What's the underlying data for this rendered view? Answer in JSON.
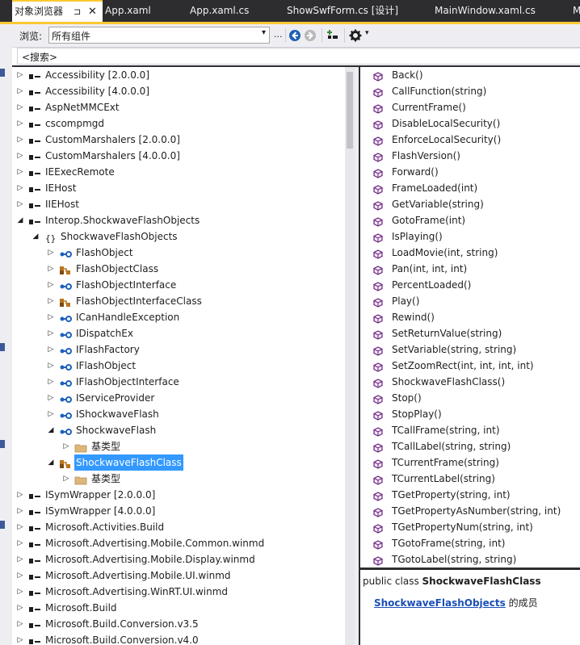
{
  "tabs": {
    "active": {
      "label": "对象浏览器",
      "pin": "⊐",
      "close": "✕"
    },
    "others": [
      "App.xaml",
      "App.xaml.cs",
      "ShowSwfForm.cs [设计]",
      "MainWindow.xaml.cs",
      "M"
    ]
  },
  "toolbar": {
    "browse_label": "浏览:",
    "browse_value": "所有组件",
    "more": "..."
  },
  "search": {
    "text": "<搜索>"
  },
  "tree": [
    {
      "label": "Accessibility [2.0.0.0]",
      "depth": 0,
      "icon": "assembly-icon",
      "exp": "collapsed"
    },
    {
      "label": "Accessibility [4.0.0.0]",
      "depth": 0,
      "icon": "assembly-icon",
      "exp": "collapsed"
    },
    {
      "label": "AspNetMMCExt",
      "depth": 0,
      "icon": "assembly-icon",
      "exp": "collapsed"
    },
    {
      "label": "cscompmgd",
      "depth": 0,
      "icon": "assembly-icon",
      "exp": "collapsed"
    },
    {
      "label": "CustomMarshalers [2.0.0.0]",
      "depth": 0,
      "icon": "assembly-icon",
      "exp": "collapsed"
    },
    {
      "label": "CustomMarshalers [4.0.0.0]",
      "depth": 0,
      "icon": "assembly-icon",
      "exp": "collapsed"
    },
    {
      "label": "IEExecRemote",
      "depth": 0,
      "icon": "assembly-icon",
      "exp": "collapsed"
    },
    {
      "label": "IEHost",
      "depth": 0,
      "icon": "assembly-icon",
      "exp": "collapsed"
    },
    {
      "label": "IIEHost",
      "depth": 0,
      "icon": "assembly-icon",
      "exp": "collapsed"
    },
    {
      "label": "Interop.ShockwaveFlashObjects",
      "depth": 0,
      "icon": "assembly-icon",
      "exp": "expanded"
    },
    {
      "label": "ShockwaveFlashObjects",
      "depth": 1,
      "icon": "namespace-icon",
      "exp": "expanded"
    },
    {
      "label": "FlashObject",
      "depth": 2,
      "icon": "interface-icon",
      "exp": "collapsed"
    },
    {
      "label": "FlashObjectClass",
      "depth": 2,
      "icon": "class-icon",
      "exp": "collapsed"
    },
    {
      "label": "FlashObjectInterface",
      "depth": 2,
      "icon": "interface-icon",
      "exp": "collapsed"
    },
    {
      "label": "FlashObjectInterfaceClass",
      "depth": 2,
      "icon": "class-icon",
      "exp": "collapsed"
    },
    {
      "label": "ICanHandleException",
      "depth": 2,
      "icon": "interface-icon",
      "exp": "collapsed"
    },
    {
      "label": "IDispatchEx",
      "depth": 2,
      "icon": "interface-icon",
      "exp": "collapsed"
    },
    {
      "label": "IFlashFactory",
      "depth": 2,
      "icon": "interface-icon",
      "exp": "collapsed"
    },
    {
      "label": "IFlashObject",
      "depth": 2,
      "icon": "interface-icon",
      "exp": "collapsed"
    },
    {
      "label": "IFlashObjectInterface",
      "depth": 2,
      "icon": "interface-icon",
      "exp": "collapsed"
    },
    {
      "label": "IServiceProvider",
      "depth": 2,
      "icon": "interface-icon",
      "exp": "collapsed"
    },
    {
      "label": "IShockwaveFlash",
      "depth": 2,
      "icon": "interface-icon",
      "exp": "collapsed"
    },
    {
      "label": "ShockwaveFlash",
      "depth": 2,
      "icon": "interface-icon",
      "exp": "expanded"
    },
    {
      "label": "基类型",
      "depth": 3,
      "icon": "folder-icon",
      "exp": "collapsed"
    },
    {
      "label": "ShockwaveFlashClass",
      "depth": 2,
      "icon": "class-icon",
      "exp": "expanded",
      "selected": true
    },
    {
      "label": "基类型",
      "depth": 3,
      "icon": "folder-icon",
      "exp": "collapsed"
    },
    {
      "label": "ISymWrapper [2.0.0.0]",
      "depth": 0,
      "icon": "assembly-icon",
      "exp": "collapsed"
    },
    {
      "label": "ISymWrapper [4.0.0.0]",
      "depth": 0,
      "icon": "assembly-icon",
      "exp": "collapsed"
    },
    {
      "label": "Microsoft.Activities.Build",
      "depth": 0,
      "icon": "assembly-icon",
      "exp": "collapsed"
    },
    {
      "label": "Microsoft.Advertising.Mobile.Common.winmd",
      "depth": 0,
      "icon": "assembly-icon",
      "exp": "collapsed"
    },
    {
      "label": "Microsoft.Advertising.Mobile.Display.winmd",
      "depth": 0,
      "icon": "assembly-icon",
      "exp": "collapsed"
    },
    {
      "label": "Microsoft.Advertising.Mobile.UI.winmd",
      "depth": 0,
      "icon": "assembly-icon",
      "exp": "collapsed"
    },
    {
      "label": "Microsoft.Advertising.WinRT.UI.winmd",
      "depth": 0,
      "icon": "assembly-icon",
      "exp": "collapsed"
    },
    {
      "label": "Microsoft.Build",
      "depth": 0,
      "icon": "assembly-icon",
      "exp": "collapsed"
    },
    {
      "label": "Microsoft.Build.Conversion.v3.5",
      "depth": 0,
      "icon": "assembly-icon",
      "exp": "collapsed"
    },
    {
      "label": "Microsoft.Build.Conversion.v4.0",
      "depth": 0,
      "icon": "assembly-icon",
      "exp": "collapsed"
    }
  ],
  "members": [
    "Back()",
    "CallFunction(string)",
    "CurrentFrame()",
    "DisableLocalSecurity()",
    "EnforceLocalSecurity()",
    "FlashVersion()",
    "Forward()",
    "FrameLoaded(int)",
    "GetVariable(string)",
    "GotoFrame(int)",
    "IsPlaying()",
    "LoadMovie(int, string)",
    "Pan(int, int, int)",
    "PercentLoaded()",
    "Play()",
    "Rewind()",
    "SetReturnValue(string)",
    "SetVariable(string, string)",
    "SetZoomRect(int, int, int, int)",
    "ShockwaveFlashClass()",
    "Stop()",
    "StopPlay()",
    "TCallFrame(string, int)",
    "TCallLabel(string, string)",
    "TCurrentFrame(string)",
    "TCurrentLabel(string)",
    "TGetProperty(string, int)",
    "TGetPropertyAsNumber(string, int)",
    "TGetPropertyNum(string, int)",
    "TGotoFrame(string, int)",
    "TGotoLabel(string, string)"
  ],
  "description": {
    "prefix": "public class ",
    "class_name": "ShockwaveFlashClass",
    "namespace_link": "ShockwaveFlashObjects",
    "suffix": " 的成员"
  },
  "colors": {
    "accent": "#fcc832",
    "selection": "#3399ff",
    "method": "#68217a",
    "interface": "#1c62b9",
    "class": "#b9761c"
  }
}
